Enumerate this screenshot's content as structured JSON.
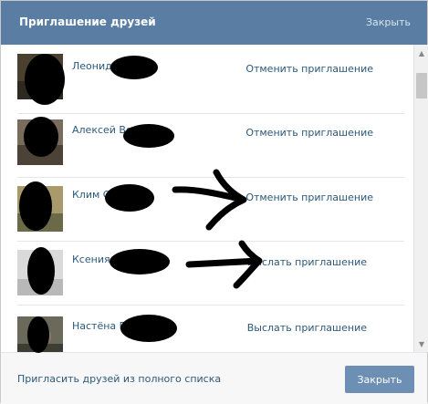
{
  "header": {
    "title": "Приглашение друзей",
    "close_label": "Закрыть"
  },
  "friends": [
    {
      "name": "Леонид",
      "action": "Отменить приглашение"
    },
    {
      "name": "Алексей Во",
      "action": "Отменить приглашение"
    },
    {
      "name": "Клим О",
      "action": "Отменить приглашение"
    },
    {
      "name": "Ксения",
      "action": "Выслать приглашение"
    },
    {
      "name": "Настёна Б",
      "action": "Выслать приглашение"
    }
  ],
  "footer": {
    "invite_all_label": "Пригласить друзей из полного списка",
    "close_button_label": "Закрыть"
  },
  "colors": {
    "header_bg": "#597da3",
    "link": "#2b587a",
    "button_bg": "#6d8fb3"
  }
}
